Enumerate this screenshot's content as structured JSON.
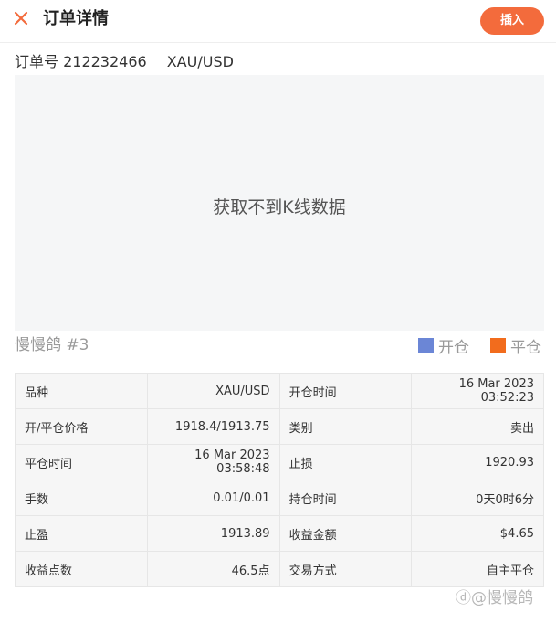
{
  "header": {
    "title": "订单详情",
    "close_icon": "close-icon",
    "insert_label": "插入",
    "accent_color": "#f36b3c"
  },
  "order": {
    "number_label": "订单号 212232466",
    "symbol": "XAU/USD"
  },
  "chart": {
    "empty_message": "获取不到K线数据"
  },
  "owner": {
    "name": "慢慢鸽 #3"
  },
  "legend": {
    "open_label": "开仓",
    "open_color": "#6b86d6",
    "close_label": "平仓",
    "close_color": "#f26c1d"
  },
  "details": {
    "rows": [
      {
        "l1": "品种",
        "v1": "XAU/USD",
        "l2": "开仓时间",
        "v2": "16 Mar 2023 03:52:23"
      },
      {
        "l1": "开/平仓价格",
        "v1": "1918.4/1913.75",
        "l2": "类别",
        "v2": "卖出"
      },
      {
        "l1": "平仓时间",
        "v1": "16 Mar 2023 03:58:48",
        "l2": "止损",
        "v2": "1920.93"
      },
      {
        "l1": "手数",
        "v1": "0.01/0.01",
        "l2": "持仓时间",
        "v2": "0天0时6分"
      },
      {
        "l1": "止盈",
        "v1": "1913.89",
        "l2": "收益金额",
        "v2": "$4.65"
      },
      {
        "l1": "收益点数",
        "v1": "46.5点",
        "l2": "交易方式",
        "v2": "自主平仓"
      }
    ]
  },
  "watermark": {
    "text": "慢慢鸽"
  }
}
